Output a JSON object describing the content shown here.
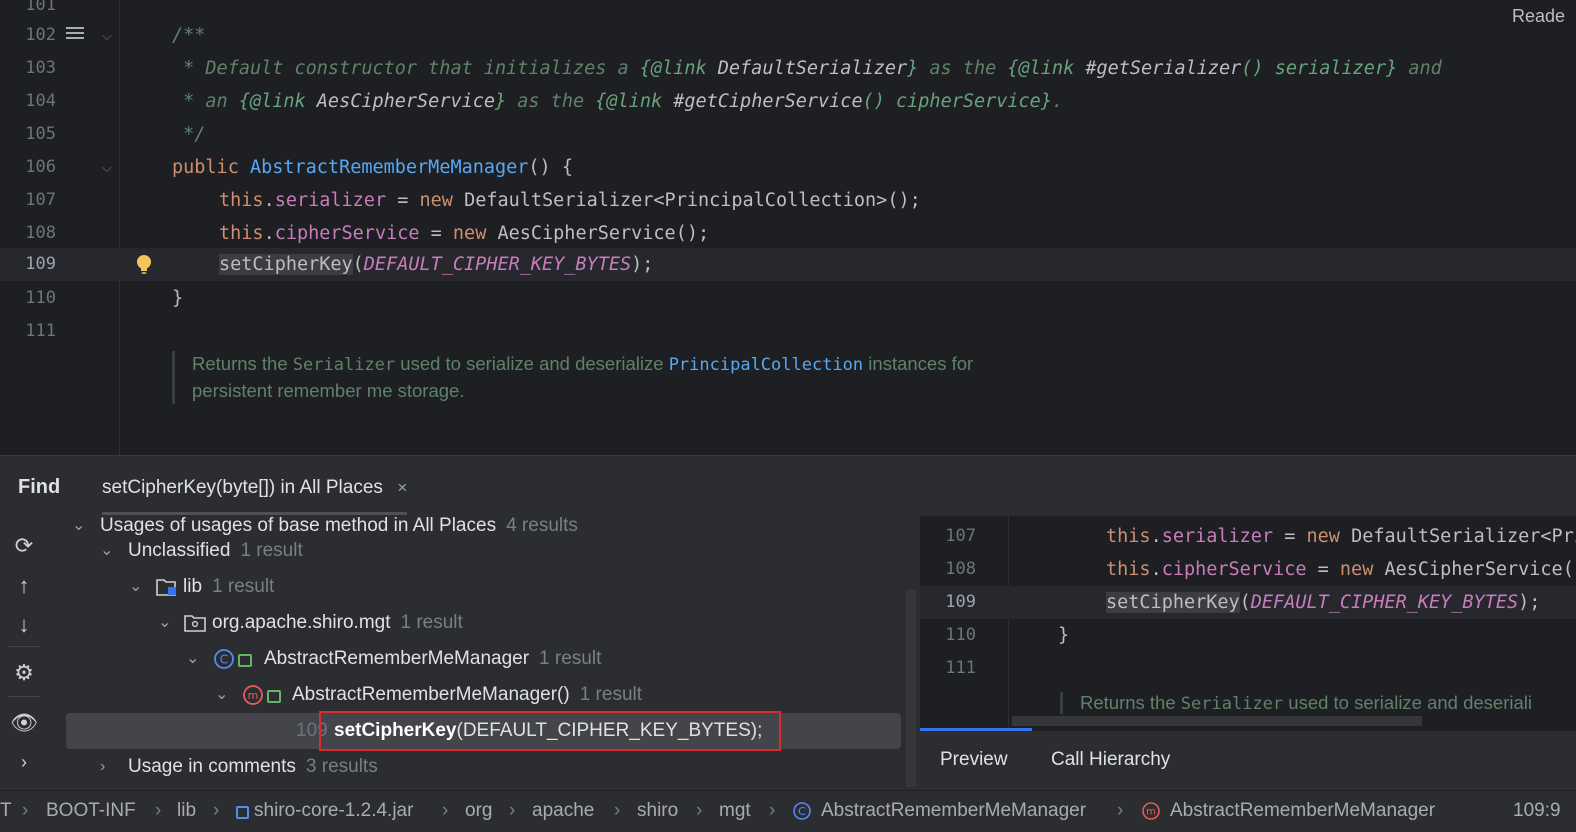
{
  "editor": {
    "reader_mode": "Reade",
    "lines": [
      {
        "num": "101"
      },
      {
        "num": "102",
        "text": "/**"
      },
      {
        "num": "103"
      },
      {
        "num": "104"
      },
      {
        "num": "105",
        "text": " */"
      },
      {
        "num": "106"
      },
      {
        "num": "107"
      },
      {
        "num": "108"
      },
      {
        "num": "109"
      },
      {
        "num": "110",
        "text": "}"
      },
      {
        "num": "111"
      }
    ],
    "l103": {
      "a": " * Default constructor that initializes a ",
      "b": "{@link ",
      "c": "DefaultSerializer",
      "d": "}",
      "e": " as the ",
      "f": "{@link ",
      "g": "#getSerializer",
      "h": "()",
      "i": " serializer",
      "j": "}",
      "k": " and"
    },
    "l104": {
      "a": " * an ",
      "b": "{@link ",
      "c": "AesCipherService",
      "d": "}",
      "e": " as the ",
      "f": "{@link ",
      "g": "#getCipherService",
      "h": "()",
      "i": " cipherService",
      "j": "}",
      "k": "."
    },
    "l106": {
      "kw": "public ",
      "fn": "AbstractRememberMeManager",
      "rest": "() {"
    },
    "l107": {
      "this": "this",
      "dot": ".",
      "fld": "serializer",
      "eq": " = ",
      "new": "new ",
      "rest": "DefaultSerializer<PrincipalCollection>();"
    },
    "l108": {
      "this": "this",
      "dot": ".",
      "fld": "cipherService",
      "eq": " = ",
      "new": "new ",
      "rest": "AesCipherService();"
    },
    "l109": {
      "call": "setCipherKey",
      "open": "(",
      "const": "DEFAULT_CIPHER_KEY_BYTES",
      "close": ");"
    },
    "doc": {
      "a": "Returns the ",
      "b": "Serializer",
      "c": " used to serialize and deserialize ",
      "d": "PrincipalCollection",
      "e": " instances for",
      "f": "persistent remember me storage."
    }
  },
  "find": {
    "title": "Find",
    "tab_label": "setCipherKey(byte[]) in All Places",
    "tab_close": "×",
    "tree": {
      "partial_row": "Usages of usages of base method in All Places",
      "partial_count": "4 results",
      "unclassified": "Unclassified",
      "unclassified_count": "1 result",
      "lib": "lib",
      "lib_count": "1 result",
      "package": "org.apache.shiro.mgt",
      "package_count": "1 result",
      "class": "AbstractRememberMeManager",
      "class_count": "1 result",
      "method": "AbstractRememberMeManager()",
      "method_count": "1 result",
      "result_line": "109",
      "result_call": "setCipherKey",
      "result_args": "(DEFAULT_CIPHER_KEY_BYTES);",
      "comments": "Usage in comments",
      "comments_count": "3 results"
    },
    "preview": {
      "lines": [
        "107",
        "108",
        "109",
        "110",
        "111"
      ],
      "l110": "}",
      "doc_a": "Returns the ",
      "doc_b": "Serializer",
      "doc_c": " used to serialize and deseriali"
    },
    "preview_tabs": [
      "Preview",
      "Call Hierarchy"
    ]
  },
  "statusbar": {
    "crumbs": [
      "T",
      "BOOT-INF",
      "lib",
      "shiro-core-1.2.4.jar",
      "org",
      "apache",
      "shiro",
      "mgt",
      "AbstractRememberMeManager",
      "AbstractRememberMeManager"
    ],
    "position": "109:9"
  },
  "colors": {
    "background": "#1e1f22",
    "panel": "#2b2d30",
    "keyword": "#cf8e6d",
    "field": "#c77dbb",
    "function": "#56a8f5",
    "doc_comment": "#5f826b",
    "highlight_box": "#d92c2c"
  }
}
